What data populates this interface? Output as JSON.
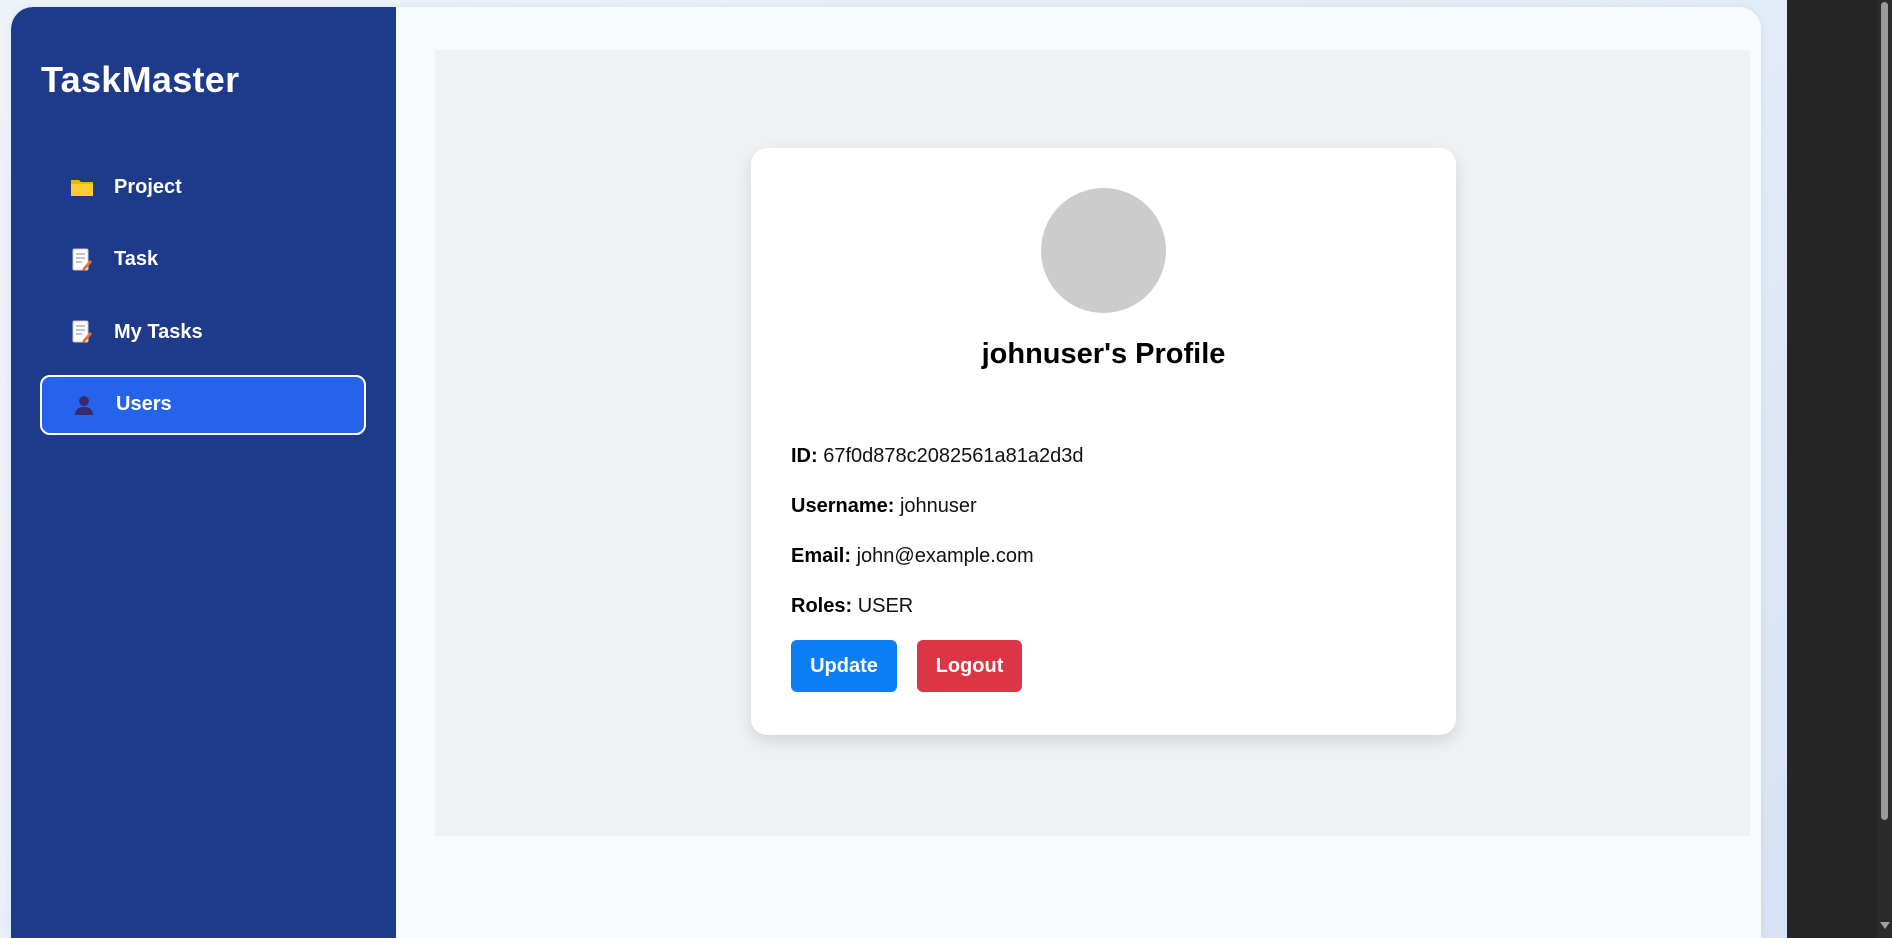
{
  "app": {
    "brand": "TaskMaster"
  },
  "sidebar": {
    "items": [
      {
        "label": "Project",
        "icon": "folder-icon",
        "active": false
      },
      {
        "label": "Task",
        "icon": "memo-icon",
        "active": false
      },
      {
        "label": "My Tasks",
        "icon": "memo-icon",
        "active": false
      },
      {
        "label": "Users",
        "icon": "user-icon",
        "active": true
      }
    ]
  },
  "profile": {
    "title": "johnuser's Profile",
    "id_label": "ID:",
    "id_value": "67f0d878c2082561a81a2d3d",
    "username_label": "Username:",
    "username_value": "johnuser",
    "email_label": "Email:",
    "email_value": "john@example.com",
    "roles_label": "Roles:",
    "roles_value": "USER"
  },
  "actions": {
    "update_label": "Update",
    "logout_label": "Logout"
  },
  "colors": {
    "sidebar_bg": "#1e3a8a",
    "active_item_bg": "#2563eb",
    "update_button": "#0d7ff5",
    "logout_button": "#dc3545",
    "avatar_placeholder": "#cccccc"
  }
}
